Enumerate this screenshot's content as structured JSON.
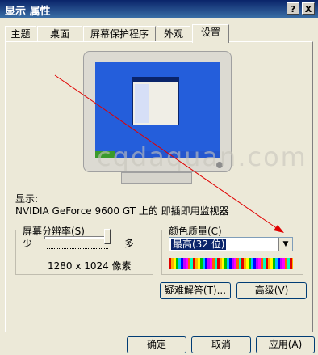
{
  "window": {
    "title": "显示 属性",
    "help_button": "?",
    "close_button": "X"
  },
  "tabs": [
    {
      "label": "主题",
      "active": false
    },
    {
      "label": "桌面",
      "active": false
    },
    {
      "label": "屏幕保护程序",
      "active": false
    },
    {
      "label": "外观",
      "active": false
    },
    {
      "label": "设置",
      "active": true
    }
  ],
  "watermark": "cqdaquan.com",
  "display": {
    "label": "显示:",
    "device": "NVIDIA GeForce 9600 GT 上的 即插即用监视器"
  },
  "resolution": {
    "group_title": "屏幕分辨率(S)",
    "min_label": "少",
    "max_label": "多",
    "value": "1280 x 1024 像素",
    "slider_fraction": 0.95
  },
  "color_quality": {
    "group_title": "颜色质量(C)",
    "selected": "最高(32 位)"
  },
  "buttons": {
    "troubleshoot": "疑难解答(T)...",
    "advanced": "高级(V)",
    "ok": "确定",
    "cancel": "取消",
    "apply": "应用(A)"
  },
  "colors": {
    "accent": "#0a246a",
    "arrow": "#e00000"
  }
}
